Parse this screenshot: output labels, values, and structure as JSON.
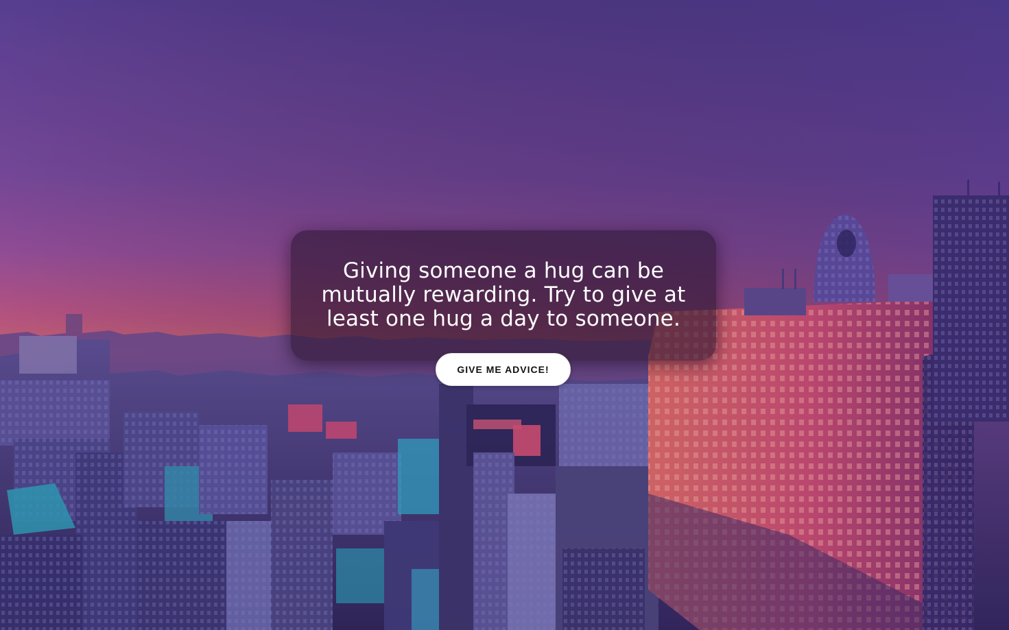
{
  "advice": {
    "text": "Giving someone a hug can be mutually rewarding. Try to give at least one hug a day to someone."
  },
  "button": {
    "label": "GIVE ME ADVICE!"
  },
  "background": {
    "description_icon": "city-skyline-background",
    "sky_top_color": "#5a4091",
    "sky_horizon_color": "#c2577e",
    "city_tint_color": "#3a2a6e",
    "building_accent_color": "#d4506a"
  }
}
